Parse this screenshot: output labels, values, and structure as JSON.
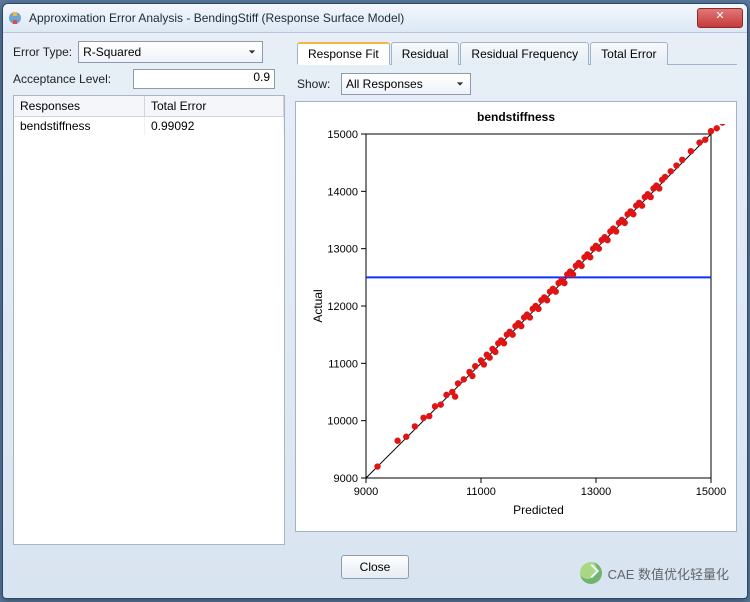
{
  "window": {
    "title": "Approximation Error Analysis - BendingStiff (Response Surface Model)"
  },
  "controls": {
    "error_type_label": "Error Type:",
    "error_type_value": "R-Squared",
    "acceptance_label": "Acceptance Level:",
    "acceptance_value": "0.9",
    "show_label": "Show:",
    "show_value": "All Responses"
  },
  "table": {
    "headers": {
      "responses": "Responses",
      "total_error": "Total Error"
    },
    "rows": [
      {
        "name": "bendstiffness",
        "value": "0.99092"
      }
    ]
  },
  "tabs": {
    "response_fit": "Response Fit",
    "residual": "Residual",
    "residual_frequency": "Residual Frequency",
    "total_error": "Total Error"
  },
  "buttons": {
    "close": "Close"
  },
  "watermark": "CAE 数值优化轻量化",
  "chart_data": {
    "type": "scatter",
    "title": "bendstiffness",
    "xlabel": "Predicted",
    "ylabel": "Actual",
    "xlim": [
      9000,
      15000
    ],
    "ylim": [
      9000,
      15000
    ],
    "x_ticks": [
      9000,
      11000,
      13000,
      15000
    ],
    "y_ticks": [
      9000,
      10000,
      11000,
      12000,
      13000,
      14000,
      15000
    ],
    "reference_lines": [
      {
        "kind": "identity",
        "color": "#000000"
      },
      {
        "kind": "horizontal",
        "y": 12500,
        "color": "#1030ff"
      }
    ],
    "series": [
      {
        "name": "fit",
        "color": "#e01414",
        "points": [
          [
            9200,
            9200
          ],
          [
            9550,
            9650
          ],
          [
            9700,
            9720
          ],
          [
            9850,
            9900
          ],
          [
            10000,
            10050
          ],
          [
            10100,
            10080
          ],
          [
            10200,
            10250
          ],
          [
            10300,
            10280
          ],
          [
            10400,
            10450
          ],
          [
            10500,
            10500
          ],
          [
            10550,
            10420
          ],
          [
            10600,
            10650
          ],
          [
            10700,
            10720
          ],
          [
            10800,
            10850
          ],
          [
            10850,
            10780
          ],
          [
            10900,
            10950
          ],
          [
            11000,
            11050
          ],
          [
            11050,
            10980
          ],
          [
            11100,
            11150
          ],
          [
            11150,
            11100
          ],
          [
            11200,
            11250
          ],
          [
            11250,
            11200
          ],
          [
            11300,
            11350
          ],
          [
            11350,
            11400
          ],
          [
            11400,
            11350
          ],
          [
            11450,
            11500
          ],
          [
            11500,
            11550
          ],
          [
            11550,
            11500
          ],
          [
            11600,
            11650
          ],
          [
            11650,
            11700
          ],
          [
            11700,
            11650
          ],
          [
            11750,
            11800
          ],
          [
            11800,
            11850
          ],
          [
            11850,
            11800
          ],
          [
            11900,
            11950
          ],
          [
            11950,
            12000
          ],
          [
            12000,
            11950
          ],
          [
            12050,
            12100
          ],
          [
            12100,
            12150
          ],
          [
            12150,
            12100
          ],
          [
            12200,
            12250
          ],
          [
            12250,
            12300
          ],
          [
            12300,
            12250
          ],
          [
            12350,
            12400
          ],
          [
            12400,
            12450
          ],
          [
            12450,
            12400
          ],
          [
            12500,
            12550
          ],
          [
            12550,
            12600
          ],
          [
            12600,
            12550
          ],
          [
            12650,
            12700
          ],
          [
            12700,
            12750
          ],
          [
            12750,
            12700
          ],
          [
            12800,
            12850
          ],
          [
            12850,
            12900
          ],
          [
            12900,
            12850
          ],
          [
            12950,
            13000
          ],
          [
            13000,
            13050
          ],
          [
            13050,
            13000
          ],
          [
            13100,
            13150
          ],
          [
            13150,
            13200
          ],
          [
            13200,
            13150
          ],
          [
            13250,
            13300
          ],
          [
            13300,
            13350
          ],
          [
            13350,
            13300
          ],
          [
            13400,
            13450
          ],
          [
            13450,
            13500
          ],
          [
            13500,
            13450
          ],
          [
            13550,
            13600
          ],
          [
            13600,
            13650
          ],
          [
            13650,
            13600
          ],
          [
            13700,
            13750
          ],
          [
            13750,
            13800
          ],
          [
            13800,
            13750
          ],
          [
            13850,
            13900
          ],
          [
            13900,
            13950
          ],
          [
            13950,
            13900
          ],
          [
            14000,
            14050
          ],
          [
            14050,
            14100
          ],
          [
            14100,
            14050
          ],
          [
            14150,
            14200
          ],
          [
            14200,
            14250
          ],
          [
            14300,
            14350
          ],
          [
            14400,
            14450
          ],
          [
            14500,
            14550
          ],
          [
            14650,
            14700
          ],
          [
            14800,
            14850
          ],
          [
            14900,
            14900
          ],
          [
            15000,
            15050
          ],
          [
            15100,
            15100
          ],
          [
            15200,
            15200
          ]
        ]
      }
    ]
  }
}
